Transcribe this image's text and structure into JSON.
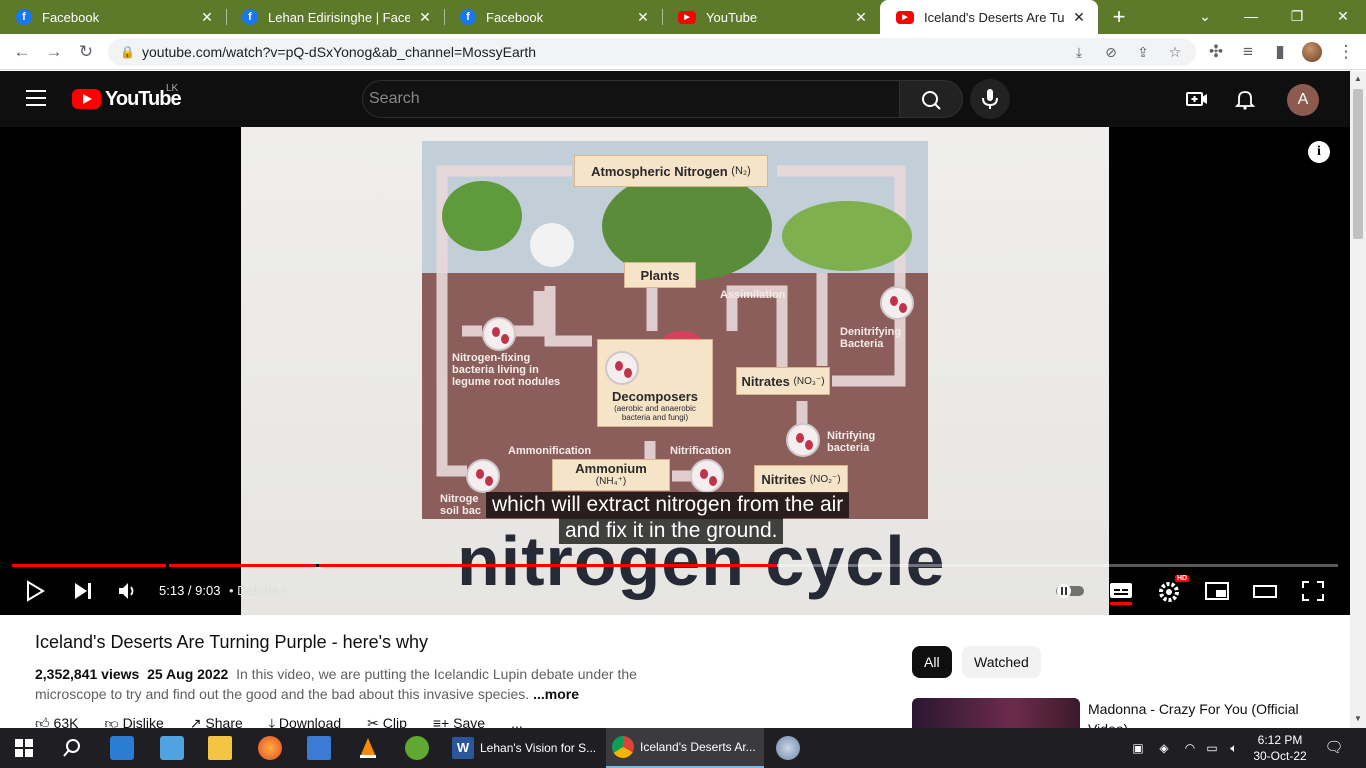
{
  "browser": {
    "tabs": [
      {
        "title": "Facebook",
        "favicon": "facebook-icon",
        "active": false
      },
      {
        "title": "Lehan Edirisinghe | Facebook",
        "favicon": "facebook-icon",
        "active": false
      },
      {
        "title": "Facebook",
        "favicon": "facebook-icon",
        "active": false
      },
      {
        "title": "YouTube",
        "favicon": "youtube-icon",
        "active": false
      },
      {
        "title": "Iceland's Deserts Are Turning Purple - here's why",
        "favicon": "youtube-icon",
        "active": true
      }
    ],
    "close_glyph": "✕",
    "new_tab_glyph": "+",
    "url": "youtube.com/watch?v=pQ-dSxYonog&ab_channel=MossyEarth",
    "theme_color": "#5d7a2a"
  },
  "youtube": {
    "logo_text": "YouTube",
    "country_code": "LK",
    "search_placeholder": "Search",
    "avatar_letter": "A"
  },
  "video": {
    "diagram": {
      "atmospheric": "Atmospheric Nitrogen",
      "atmospheric_formula": "(N₂)",
      "plants": "Plants",
      "assimilation": "Assimilation",
      "denitrifying": "Denitrifying\nBacteria",
      "nitrogen_fixing": "Nitrogen-fixing\nbacteria living in\nlegume root nodules",
      "decomposers": "Decomposers",
      "decomposers_sub": "(aerobic and anaerobic\nbacteria and fungi)",
      "nitrates": "Nitrates",
      "nitrates_formula": "(NO₃⁻)",
      "nitrifying": "Nitrifying\nbacteria",
      "ammonification": "Ammonification",
      "nitrification": "Nitrification",
      "ammonium": "Ammonium",
      "ammonium_formula": "(NH₄⁺)",
      "nitrites": "Nitrites",
      "nitrites_formula": "(NO₂⁻)",
      "soil_fragment": "Nitroge\nsoil bac"
    },
    "subtitle_line1": "which will extract nitrogen from the air",
    "subtitle_line2": "and fix it in the ground.",
    "overlay_caption": "nitrogen cycle",
    "time": "5:13 / 9:03",
    "chapter": "• Debate",
    "progress": {
      "played_fraction": 0.577,
      "loaded_fraction": 0.58
    },
    "info_glyph": "i",
    "hd_badge": "HD"
  },
  "details": {
    "title": "Iceland's Deserts Are Turning Purple - here's why",
    "views": "2,352,841 views",
    "date": "25 Aug 2022",
    "description": "In this video, we are putting the Icelandic Lupin debate under the microscope to try and find out the good and the bad about this invasive species.",
    "more": "...more",
    "actions": {
      "likes": "63K",
      "dislike": "Dislike",
      "share": "Share",
      "download": "Download",
      "clip": "Clip",
      "save": "Save",
      "more": "..."
    }
  },
  "recommendations": {
    "chips": [
      "All",
      "Watched"
    ],
    "first_title": "Madonna - Crazy For You (Official Video)"
  },
  "taskbar": {
    "apps": [
      {
        "label": "Lehan's Vision for S...",
        "icon": "word-icon",
        "active": false
      },
      {
        "label": "Iceland's Deserts Ar...",
        "icon": "chrome-icon",
        "active": true
      }
    ],
    "time": "6:12 PM",
    "date": "30-Oct-22"
  }
}
